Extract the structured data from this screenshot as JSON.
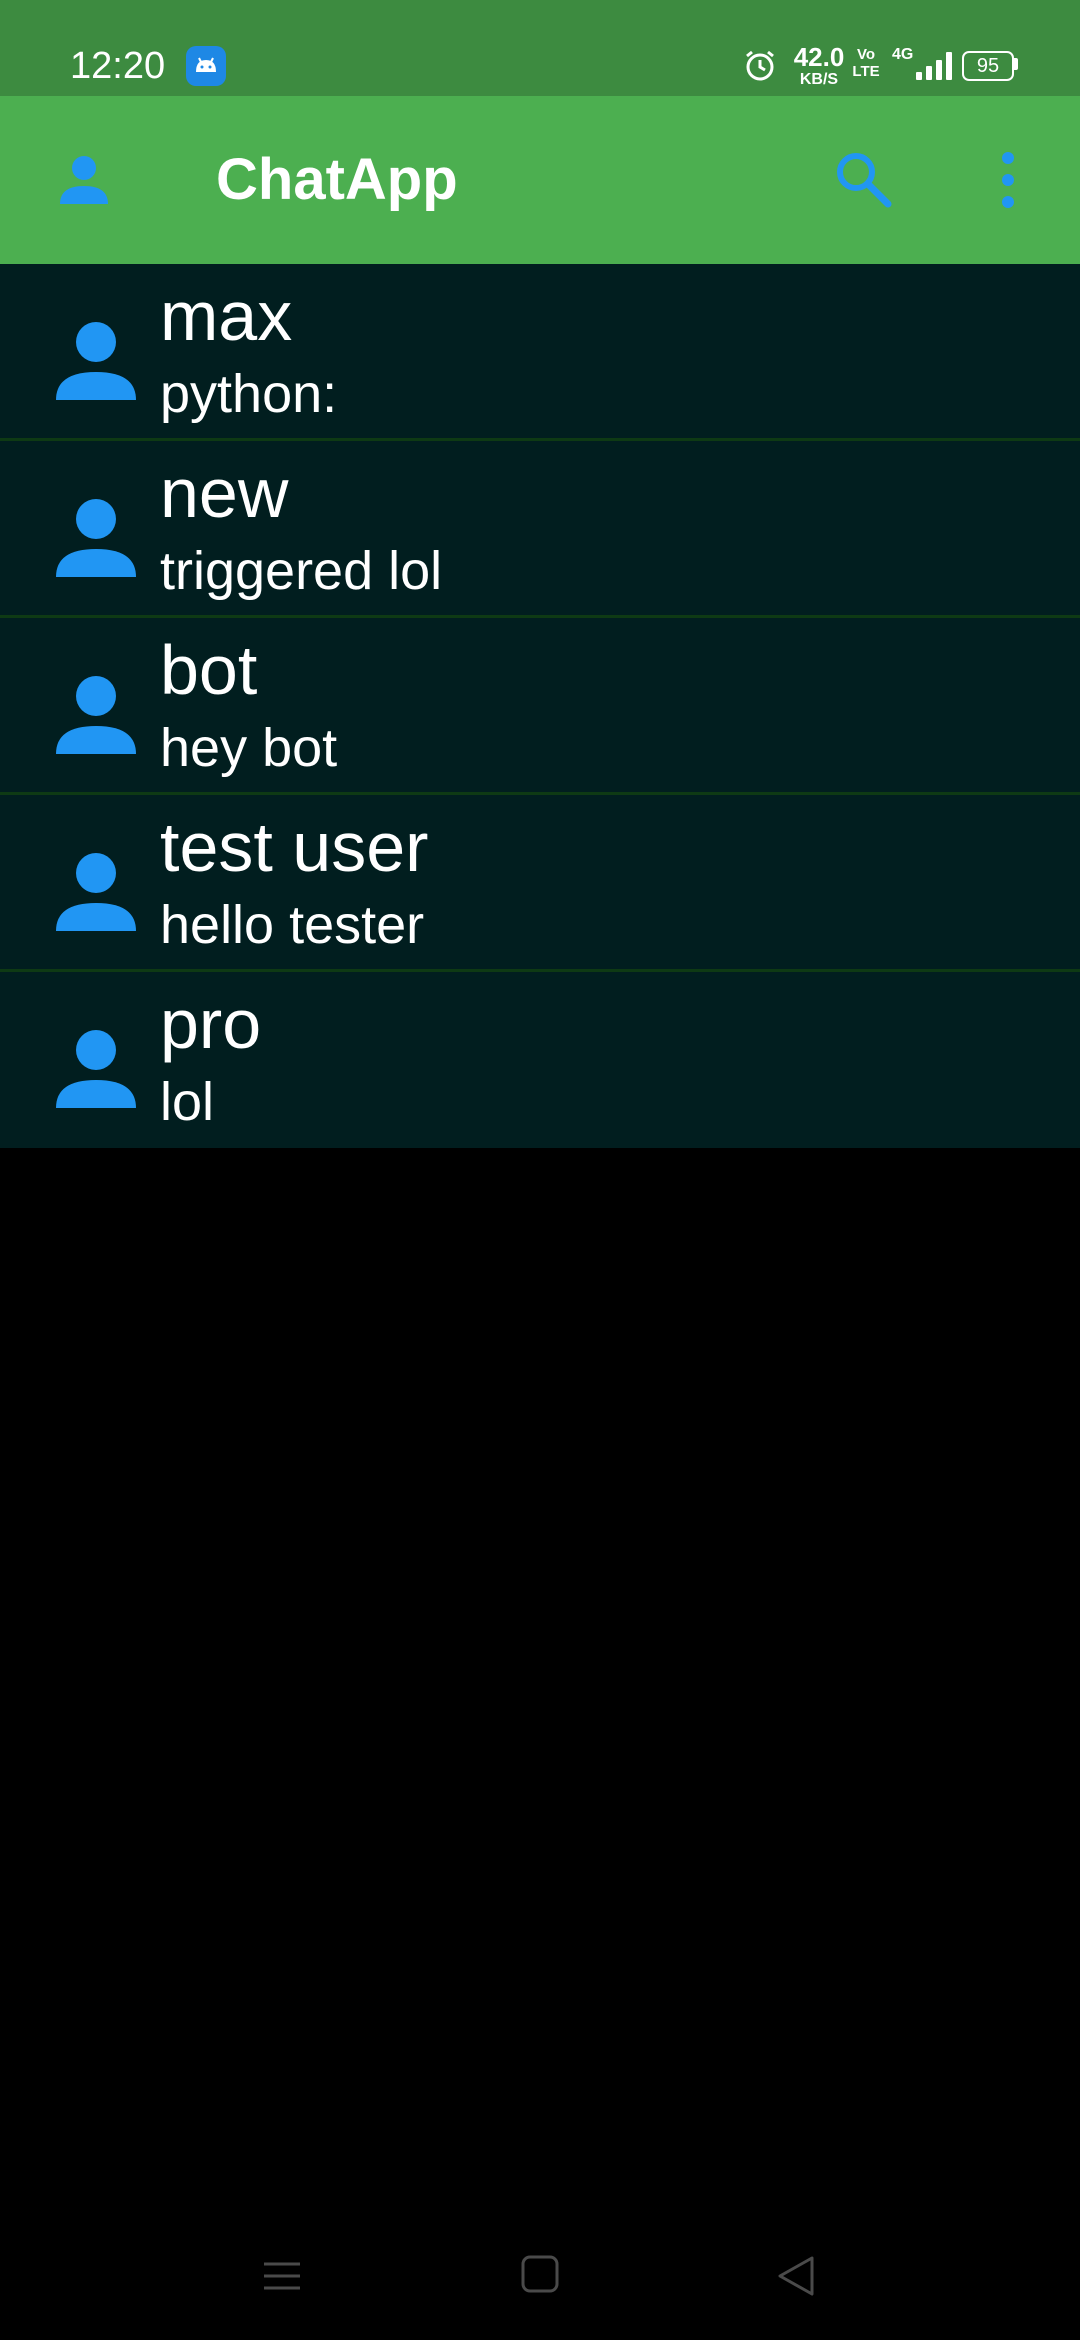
{
  "status_bar": {
    "time": "12:20",
    "net_speed_value": "42.0",
    "net_speed_unit": "KB/S",
    "volte_top": "Vo",
    "volte_bottom": "LTE",
    "network_type": "4G",
    "battery": "95",
    "icons": [
      "app-notification-icon",
      "alarm-icon",
      "signal-icon",
      "battery-icon"
    ]
  },
  "app_bar": {
    "title": "ChatApp",
    "icons": [
      "profile-icon",
      "search-icon",
      "more-vert-icon"
    ],
    "accent_color": "#4caf50",
    "icon_color": "#2196f3"
  },
  "chats": [
    {
      "name": "max",
      "last_message": "python:"
    },
    {
      "name": "new",
      "last_message": "triggered lol"
    },
    {
      "name": "bot",
      "last_message": "hey bot"
    },
    {
      "name": "test user",
      "last_message": "hello tester"
    },
    {
      "name": "pro",
      "last_message": "lol"
    }
  ],
  "nav_bar": {
    "icons": [
      "menu-icon",
      "home-icon",
      "back-icon"
    ]
  },
  "colors": {
    "status_bar": "#3d8b40",
    "list_background": "#011e1f",
    "divider": "#0e3a14",
    "page_background": "#000000"
  }
}
